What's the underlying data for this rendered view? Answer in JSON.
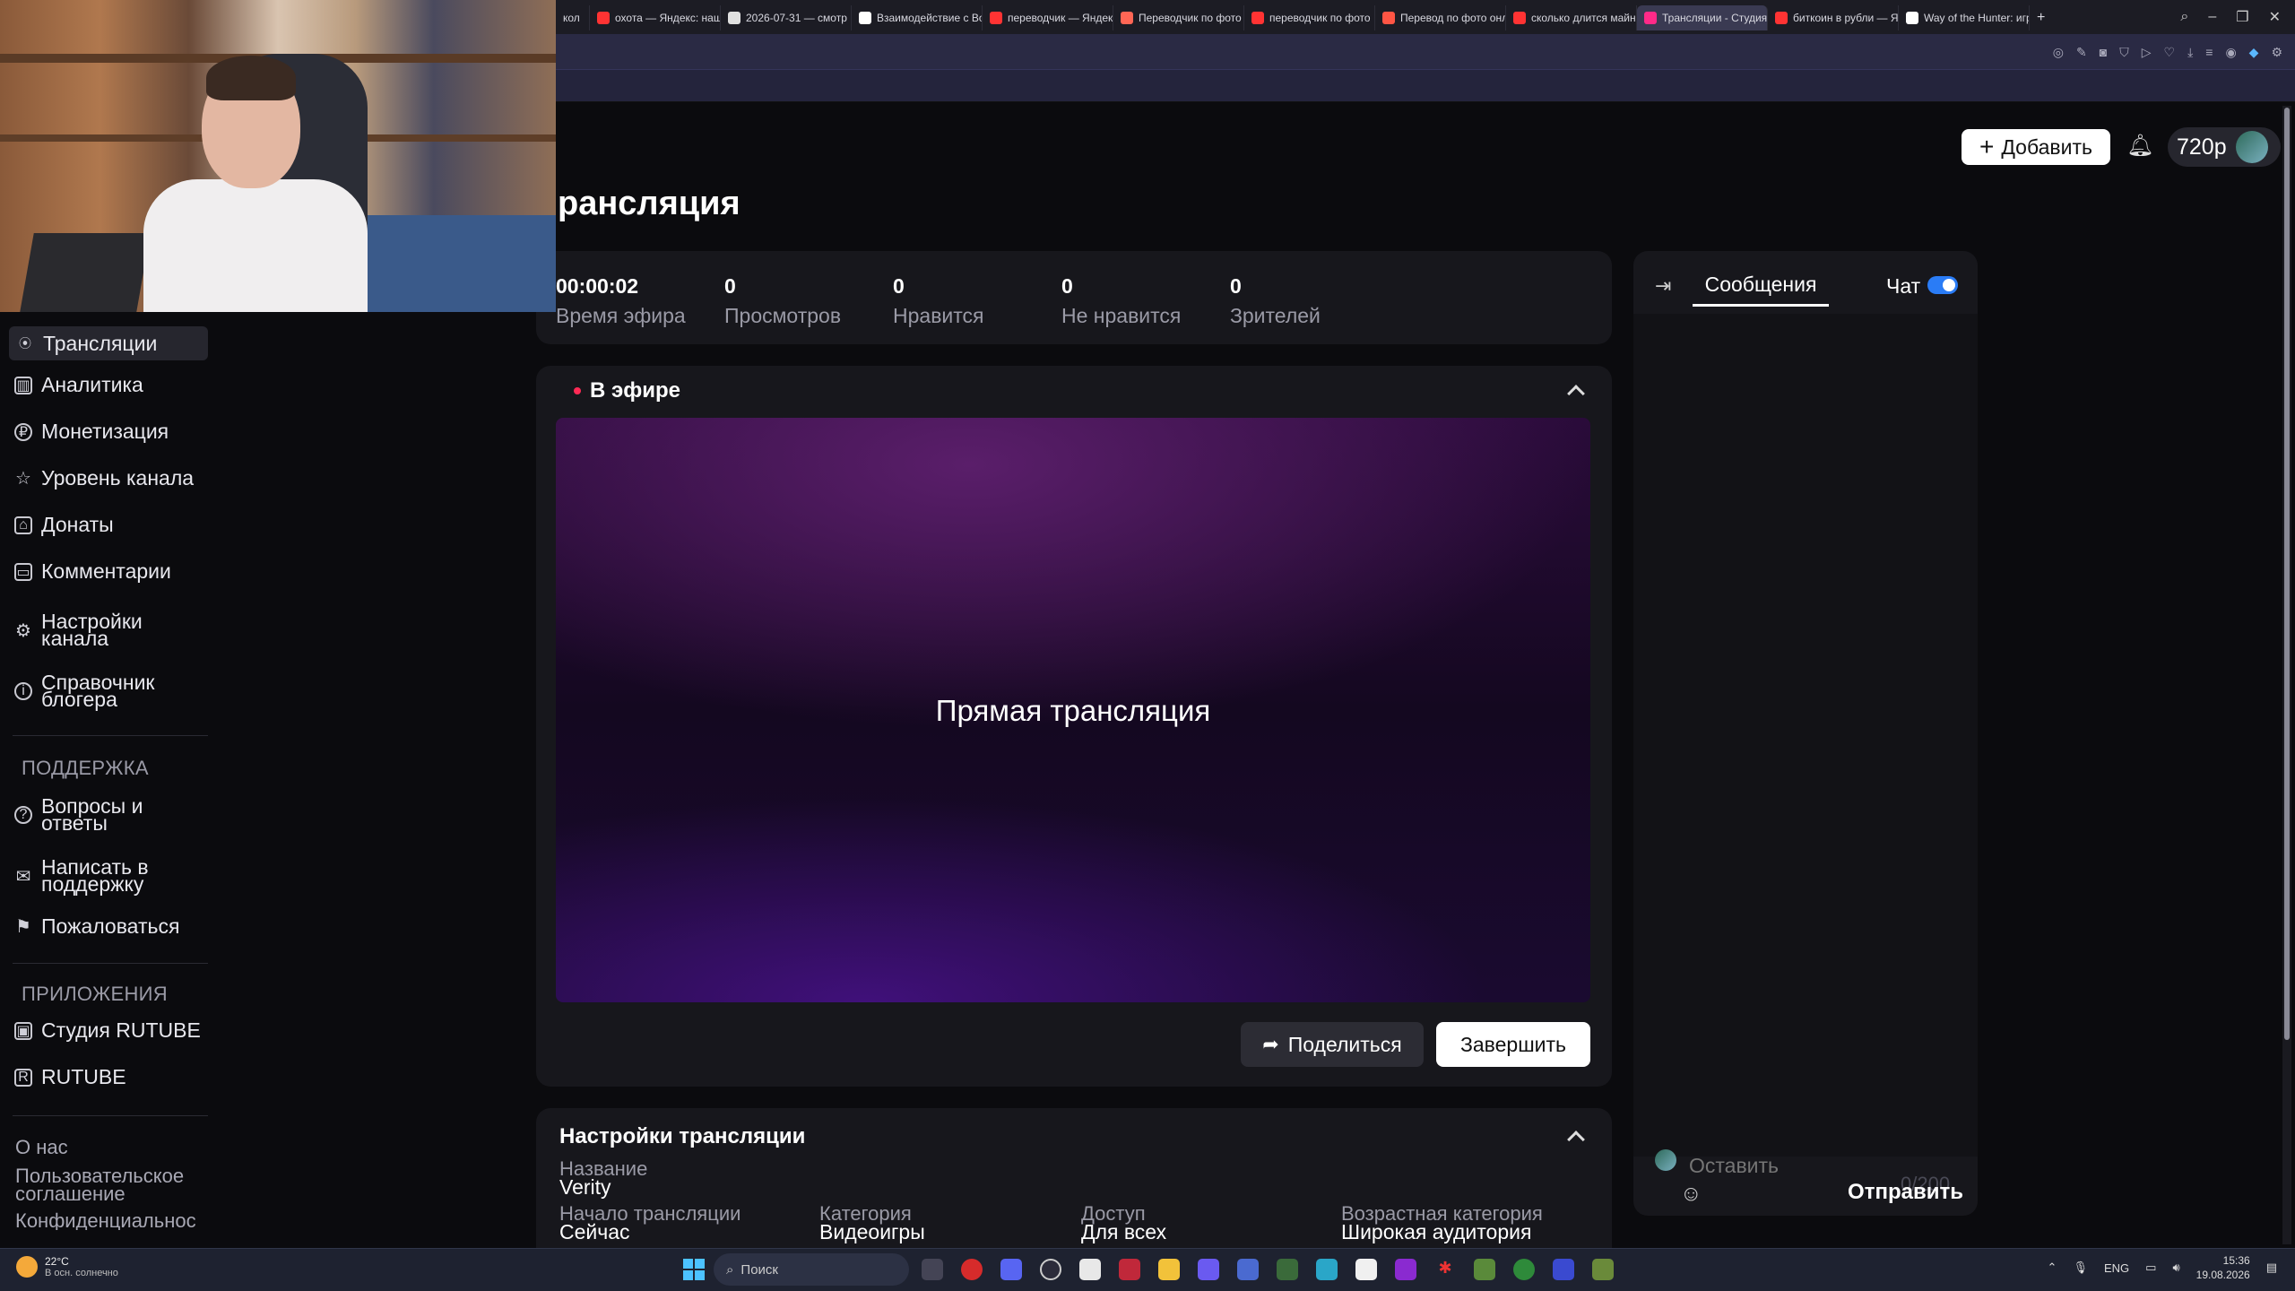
{
  "browser": {
    "tabs": [
      {
        "label": "кол",
        "color": "#888888",
        "active": false
      },
      {
        "label": "охота — Яндекс: наш",
        "color": "#ff3333",
        "active": false
      },
      {
        "label": "2026-07-31 — смотр",
        "color": "#e0e0e0",
        "active": false
      },
      {
        "label": "Взаимодействие с Во",
        "color": "#ffffff",
        "active": false
      },
      {
        "label": "переводчик — Яндек",
        "color": "#ff3333",
        "active": false
      },
      {
        "label": "Переводчик по фото",
        "color": "#ff6655",
        "active": false
      },
      {
        "label": "переводчик по фото",
        "color": "#ff3333",
        "active": false
      },
      {
        "label": "Перевод по фото онл",
        "color": "#ff5544",
        "active": false
      },
      {
        "label": "сколько длится майн",
        "color": "#ff3333",
        "active": false
      },
      {
        "label": "Трансляции - Студия RU",
        "color": "#ff2a88",
        "active": true
      },
      {
        "label": "биткоин в рубли — Я",
        "color": "#ff3333",
        "active": false
      },
      {
        "label": "Way of the Hunter: игр",
        "color": "#ffffff",
        "active": false
      }
    ]
  },
  "sidebar": {
    "items": [
      {
        "label": "Трансляции",
        "icon": "broadcast-icon",
        "glyph": "((·))",
        "active": true
      },
      {
        "label": "Аналитика",
        "icon": "analytics-icon",
        "glyph": "▥"
      },
      {
        "label": "Монетизация",
        "icon": "ruble-icon",
        "glyph": "₽"
      },
      {
        "label": "Уровень канала",
        "icon": "star-icon",
        "glyph": "☆"
      },
      {
        "label": "Донаты",
        "icon": "gift-icon",
        "glyph": "⌂"
      },
      {
        "label": "Комментарии",
        "icon": "comment-icon",
        "glyph": "▭"
      },
      {
        "label": "Настройки канала",
        "icon": "gear-icon",
        "glyph": "⚙"
      },
      {
        "label": "Справочник блогера",
        "icon": "info-icon",
        "glyph": "i"
      }
    ],
    "support_title": "ПОДДЕРЖКА",
    "support_items": [
      {
        "label": "Вопросы и ответы",
        "icon": "question-icon",
        "glyph": "?"
      },
      {
        "label": "Написать в поддержку",
        "icon": "mail-icon",
        "glyph": "✉"
      },
      {
        "label": "Пожаловаться",
        "icon": "flag-icon",
        "glyph": "⚑"
      }
    ],
    "apps_title": "ПРИЛОЖЕНИЯ",
    "apps_items": [
      {
        "label": "Студия RUTUBE",
        "icon": "studio-icon",
        "glyph": "▣"
      },
      {
        "label": "RUTUBE",
        "icon": "rutube-icon",
        "glyph": "R"
      }
    ],
    "footer": [
      "О нас",
      "Пользовательское соглашение",
      "Конфиденциальнос"
    ]
  },
  "header": {
    "add_label": "Добавить",
    "quality": "720p"
  },
  "page_title": "рансляция",
  "stats": [
    {
      "value": "00:00:02",
      "label": "Время эфира"
    },
    {
      "value": "0",
      "label": "Просмотров"
    },
    {
      "value": "0",
      "label": "Нравится"
    },
    {
      "value": "0",
      "label": "Не нравится"
    },
    {
      "value": "0",
      "label": "Зрителей"
    }
  ],
  "live": {
    "title": "В эфире",
    "player_label": "Прямая трансляция",
    "share_label": "Поделиться",
    "end_label": "Завершить"
  },
  "settings": {
    "title": "Настройки трансляции",
    "name_label": "Название",
    "name_value": "Verity",
    "start_label": "Начало трансляции",
    "start_value": "Сейчас",
    "category_label": "Категория",
    "category_value": "Видеоигры",
    "access_label": "Доступ",
    "access_value": "Для всех",
    "age_label": "Возрастная категория",
    "age_value": "Широкая аудитория"
  },
  "chat": {
    "tab_label": "Сообщения",
    "toggle_label": "Чат",
    "toggle_on": true,
    "input_placeholder": "Оставить",
    "char_count": "0/200",
    "send_label": "Отправить"
  },
  "taskbar": {
    "temperature": "22°C",
    "weather_text": "В осн. солнечно",
    "search_label": "Поиск",
    "lang": "ENG",
    "time": "15:36",
    "date": "19.08.2026"
  }
}
